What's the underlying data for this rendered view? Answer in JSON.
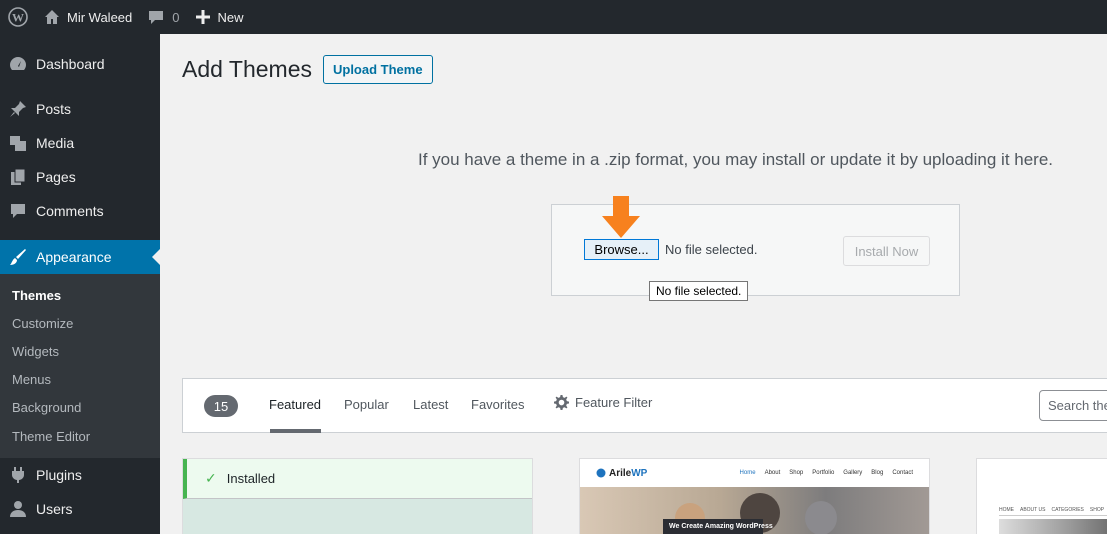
{
  "adminbar": {
    "site_name": "Mir Waleed",
    "comments_count": "0",
    "new_label": "New"
  },
  "sidebar": {
    "items": [
      {
        "label": "Dashboard",
        "icon": "dashboard-icon"
      },
      {
        "label": "Posts",
        "icon": "pin-icon"
      },
      {
        "label": "Media",
        "icon": "media-icon"
      },
      {
        "label": "Pages",
        "icon": "pages-icon"
      },
      {
        "label": "Comments",
        "icon": "comment-icon"
      },
      {
        "label": "Appearance",
        "icon": "brush-icon",
        "current": true
      },
      {
        "label": "Plugins",
        "icon": "plugin-icon"
      },
      {
        "label": "Users",
        "icon": "users-icon"
      }
    ],
    "submenu": [
      "Themes",
      "Customize",
      "Widgets",
      "Menus",
      "Background",
      "Theme Editor"
    ]
  },
  "page": {
    "title": "Add Themes",
    "upload_button": "Upload Theme",
    "upload_help": "If you have a theme in a .zip format, you may install or update it by uploading it here.",
    "browse_label": "Browse...",
    "file_status": "No file selected.",
    "install_label": "Install Now",
    "tooltip": "No file selected."
  },
  "filter": {
    "count": "15",
    "tabs": [
      "Featured",
      "Popular",
      "Latest",
      "Favorites"
    ],
    "current_tab": "Featured",
    "feature_filter": "Feature Filter",
    "search_placeholder": "Search themes..."
  },
  "themes": {
    "installed_label": "Installed",
    "arile": {
      "logo_a": "Arile",
      "logo_b": "WP",
      "nav": [
        "Home",
        "About",
        "Shop",
        "Portfolio",
        "Gallery",
        "Blog",
        "Contact"
      ],
      "banner": "We Create Amazing WordPress"
    },
    "third": {
      "nav": [
        "HOME",
        "ABOUT US",
        "CATEGORIES",
        "SHOP"
      ]
    }
  },
  "colors": {
    "accent": "#0073aa",
    "sidebar_bg": "#23282d",
    "arrow": "#f7811e",
    "installed_green": "#46b450"
  }
}
